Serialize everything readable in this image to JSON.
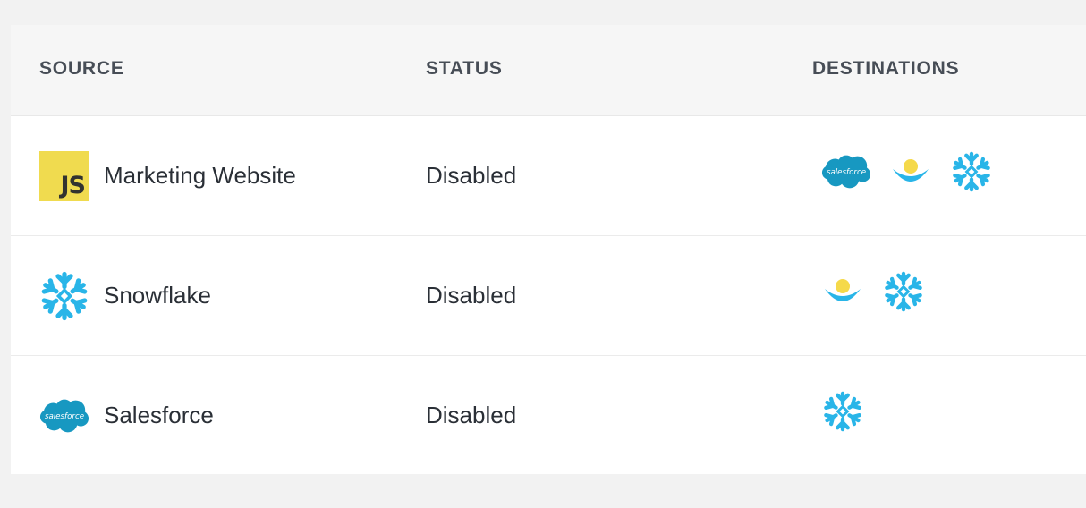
{
  "table": {
    "headers": {
      "source": "SOURCE",
      "status": "STATUS",
      "destinations": "DESTINATIONS"
    },
    "rows": [
      {
        "source_icon": "javascript-icon",
        "source_name": "Marketing Website",
        "status": "Disabled",
        "destinations": [
          "salesforce-icon",
          "sunrise-icon",
          "snowflake-icon"
        ]
      },
      {
        "source_icon": "snowflake-icon",
        "source_name": "Snowflake",
        "status": "Disabled",
        "destinations": [
          "sunrise-icon",
          "snowflake-icon"
        ]
      },
      {
        "source_icon": "salesforce-icon",
        "source_name": "Salesforce",
        "status": "Disabled",
        "destinations": [
          "snowflake-icon"
        ]
      }
    ]
  },
  "icon_text": {
    "js": "JS",
    "salesforce": "salesforce"
  },
  "colors": {
    "js_yellow": "#f0db4f",
    "brand_blue": "#29b5e8",
    "salesforce_blue": "#1798c1",
    "sun_yellow": "#f5d94a",
    "text": "#2a2f36",
    "header_text": "#474d56"
  }
}
